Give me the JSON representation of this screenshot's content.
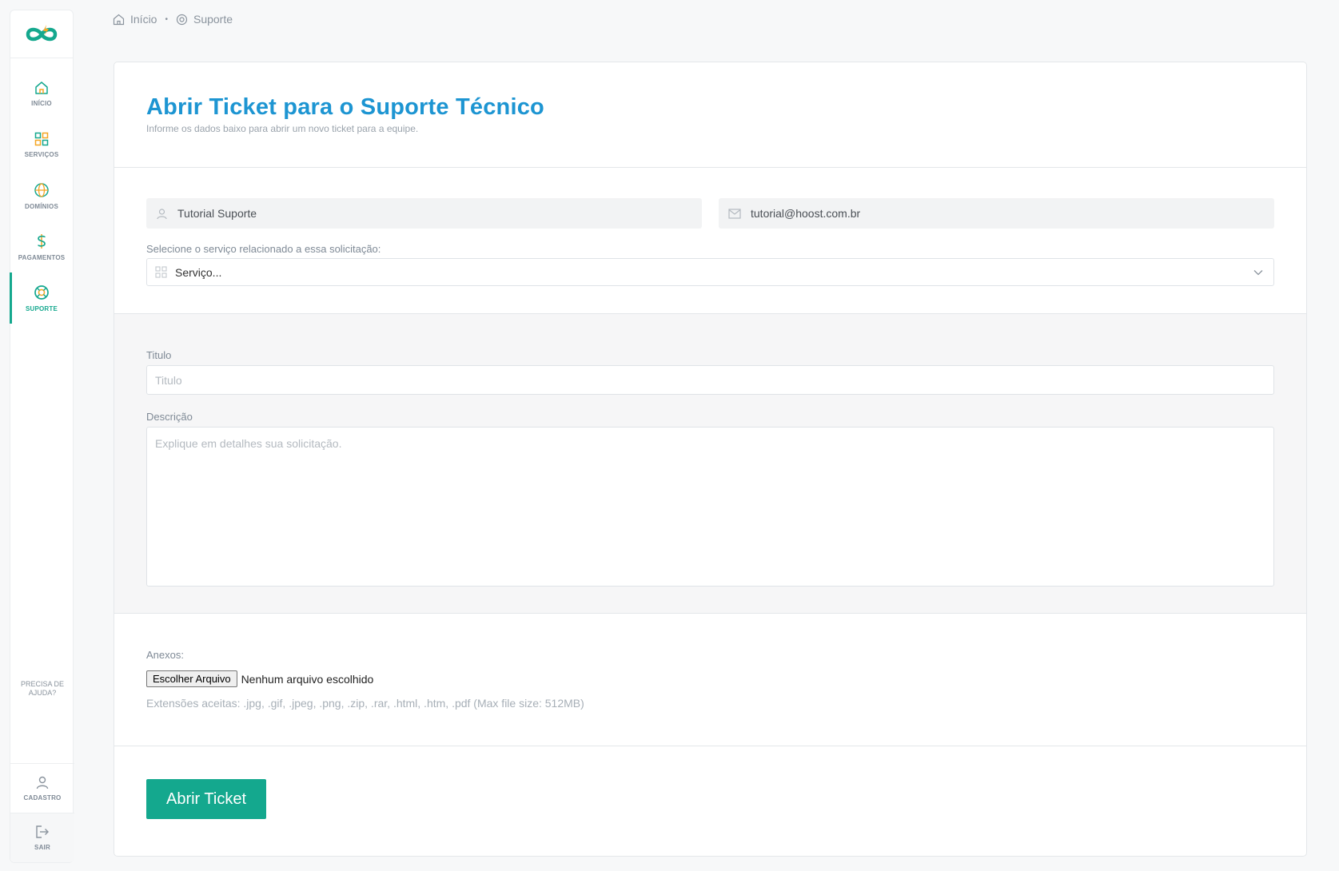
{
  "breadcrumb": {
    "home": "Início",
    "current": "Suporte"
  },
  "sidebar": {
    "items": [
      {
        "label": "INÍCIO"
      },
      {
        "label": "SERVIÇOS"
      },
      {
        "label": "DOMÍNIOS"
      },
      {
        "label": "PAGAMENTOS"
      },
      {
        "label": "SUPORTE"
      }
    ],
    "help": "PRECISA DE AJUDA?",
    "account": "CADASTRO",
    "logout": "SAIR"
  },
  "header": {
    "title": "Abrir Ticket para o Suporte Técnico",
    "subtitle": "Informe os dados baixo para abrir um novo ticket para a equipe."
  },
  "user": {
    "name": "Tutorial Suporte",
    "email": "tutorial@hoost.com.br"
  },
  "service": {
    "label": "Selecione o serviço relacionado a essa solicitação:",
    "value": "Serviço..."
  },
  "form": {
    "title_label": "Titulo",
    "title_placeholder": "Titulo",
    "desc_label": "Descrição",
    "desc_placeholder": "Explique em detalhes sua solicitação."
  },
  "attachments": {
    "label": "Anexos:",
    "button": "Escolher Arquivo",
    "status": "Nenhum arquivo escolhido",
    "extensions": "Extensões aceitas: .jpg, .gif, .jpeg, .png, .zip, .rar, .html, .htm, .pdf (Max file size: 512MB)"
  },
  "submit": "Abrir Ticket",
  "colors": {
    "accent": "#14a88e",
    "title": "#1d95d2",
    "logo_orange": "#f5a623"
  }
}
